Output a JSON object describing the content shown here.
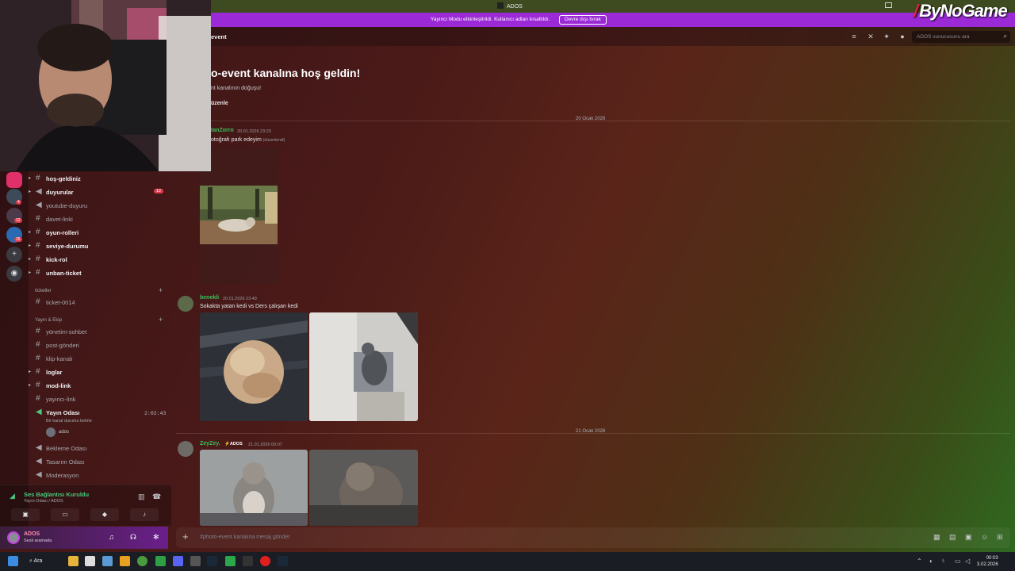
{
  "window": {
    "title": "ADOS"
  },
  "brand": {
    "logo_text": "ByNoGame"
  },
  "banner": {
    "message": "Yayıncı Modu etkinleştirildi. Kullanıcı adları kısaltıldı.",
    "button_label": "Devre dışı bırak"
  },
  "channel_header": {
    "name": "event",
    "search_placeholder": "ADOS sunucusunu ara",
    "icons": [
      "threads-icon",
      "mute-icon",
      "pin-icon",
      "members-icon"
    ]
  },
  "welcome": {
    "title": "o-event kanalına hoş geldin!",
    "subtitle": "nt kanalının doğuşu!",
    "edit_label": "üzenle"
  },
  "messages": {
    "date1": "20 Ocak 2026",
    "date2": "21 Ocak 2026",
    "m1": {
      "author": "tanZorro",
      "time": "20.01.2026 23:23",
      "text": "otoğrafı park edeyim",
      "edited": "(düzenlendi)",
      "author_color": "#3bbf5c"
    },
    "m2": {
      "author": "benekli",
      "time": "20.01.2026 23:49",
      "text": "Sokakta yatan kedi vs Ders çalışan kedi",
      "author_color": "#3bbf5c"
    },
    "m3": {
      "author": "ZeyZey.",
      "tag": "ADOS",
      "time": "21.01.2026 00:07",
      "author_color": "#3bbf5c"
    }
  },
  "servers": {
    "badges": [
      "4",
      "12",
      "26"
    ]
  },
  "sidebar": {
    "channels": [
      {
        "label": "hoş-geldiniz",
        "style": "bold",
        "arrow": true,
        "icon": "hash"
      },
      {
        "label": "duyurular",
        "style": "bold",
        "arrow": true,
        "icon": "announce",
        "badge": "12"
      },
      {
        "label": "youtube-duyuru",
        "style": "dim",
        "icon": "announce"
      },
      {
        "label": "davet-linki",
        "style": "dim",
        "icon": "hash"
      },
      {
        "label": "oyun-rolleri",
        "style": "bold",
        "arrow": true,
        "icon": "hash"
      },
      {
        "label": "seviye-durumu",
        "style": "bold",
        "arrow": true,
        "icon": "hash"
      },
      {
        "label": "kick-rol",
        "style": "bold",
        "arrow": true,
        "icon": "hash"
      },
      {
        "label": "unban-ticket",
        "style": "bold",
        "arrow": true,
        "icon": "hash"
      }
    ],
    "category_tickets": "ticketler",
    "tickets": [
      {
        "label": "ticket-0014",
        "style": "dim"
      }
    ],
    "category_yayin": "Yayın & Ekip",
    "yayin_channels": [
      {
        "label": "yönetim-sohbet",
        "style": "dim",
        "icon": "hash"
      },
      {
        "label": "post-gönderi",
        "style": "dim",
        "icon": "hash"
      },
      {
        "label": "klip-kanalı",
        "style": "dim",
        "icon": "hash"
      },
      {
        "label": "loglar",
        "style": "bold",
        "arrow": true,
        "icon": "hash"
      },
      {
        "label": "mod-link",
        "style": "bold",
        "arrow": true,
        "icon": "hash"
      },
      {
        "label": "yayıncı-link",
        "style": "dim",
        "icon": "hash"
      }
    ],
    "voice_active": {
      "label": "Yayın Odası",
      "timer": "2:02:43",
      "status": "Bir kanal durumu belirle",
      "user": "ados"
    },
    "voice_channels": [
      "Bekleme Odası",
      "Tasarım Odası",
      "Moderasyon"
    ]
  },
  "connection": {
    "title": "Ses Bağlantısı Kuruldu",
    "sub": "Yayın Odası / ADOS"
  },
  "user": {
    "name": "ADOS",
    "status": "Sesli aramada"
  },
  "composer": {
    "placeholder": "#photo-event kanalına mesaj gönder"
  },
  "taskbar": {
    "search_label": "Ara",
    "time": "00:03",
    "date": "3.02.2026"
  },
  "colors": {
    "banner": "#9b2ad6",
    "accent_green": "#3bbf5c",
    "badge_red": "#e03b4b"
  }
}
